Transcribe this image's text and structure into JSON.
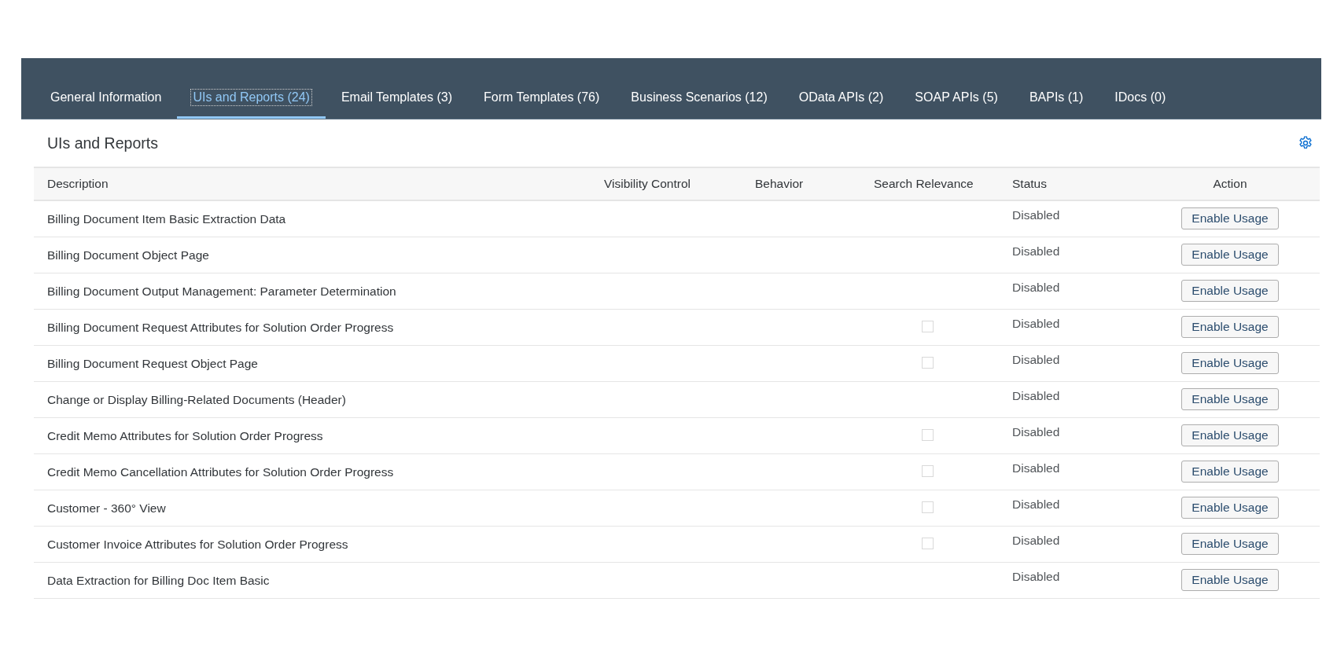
{
  "tabs": [
    {
      "label": "General Information",
      "selected": false
    },
    {
      "label": "UIs and Reports (24)",
      "selected": true
    },
    {
      "label": "Email Templates (3)",
      "selected": false
    },
    {
      "label": "Form Templates (76)",
      "selected": false
    },
    {
      "label": "Business Scenarios (12)",
      "selected": false
    },
    {
      "label": "OData APIs (2)",
      "selected": false
    },
    {
      "label": "SOAP APIs (5)",
      "selected": false
    },
    {
      "label": "BAPIs (1)",
      "selected": false
    },
    {
      "label": "IDocs (0)",
      "selected": false
    }
  ],
  "section": {
    "title": "UIs and Reports"
  },
  "table": {
    "columns": [
      "Description",
      "Visibility Control",
      "Behavior",
      "Search Relevance",
      "Status",
      "Action"
    ],
    "rows": [
      {
        "description": "Billing Document Item Basic Extraction Data",
        "status": "Disabled",
        "action": "Enable Usage"
      },
      {
        "description": "Billing Document Object Page",
        "status": "Disabled",
        "action": "Enable Usage"
      },
      {
        "description": "Billing Document Output Management: Parameter Determination",
        "status": "Disabled",
        "action": "Enable Usage"
      },
      {
        "description": "Billing Document Request Attributes for Solution Order Progress",
        "search_relevance": {
          "checked": false
        },
        "status": "Disabled",
        "action": "Enable Usage"
      },
      {
        "description": "Billing Document Request Object Page",
        "search_relevance": {
          "checked": false
        },
        "status": "Disabled",
        "action": "Enable Usage"
      },
      {
        "description": "Change or Display Billing-Related Documents (Header)",
        "status": "Disabled",
        "action": "Enable Usage"
      },
      {
        "description": "Credit Memo Attributes for Solution Order Progress",
        "search_relevance": {
          "checked": false
        },
        "status": "Disabled",
        "action": "Enable Usage"
      },
      {
        "description": "Credit Memo Cancellation Attributes for Solution Order Progress",
        "search_relevance": {
          "checked": false
        },
        "status": "Disabled",
        "action": "Enable Usage"
      },
      {
        "description": "Customer - 360° View",
        "search_relevance": {
          "checked": false
        },
        "status": "Disabled",
        "action": "Enable Usage"
      },
      {
        "description": "Customer Invoice Attributes for Solution Order Progress",
        "search_relevance": {
          "checked": false
        },
        "status": "Disabled",
        "action": "Enable Usage"
      },
      {
        "description": "Data Extraction for Billing Doc Item Basic",
        "status": "Disabled",
        "action": "Enable Usage"
      }
    ]
  }
}
